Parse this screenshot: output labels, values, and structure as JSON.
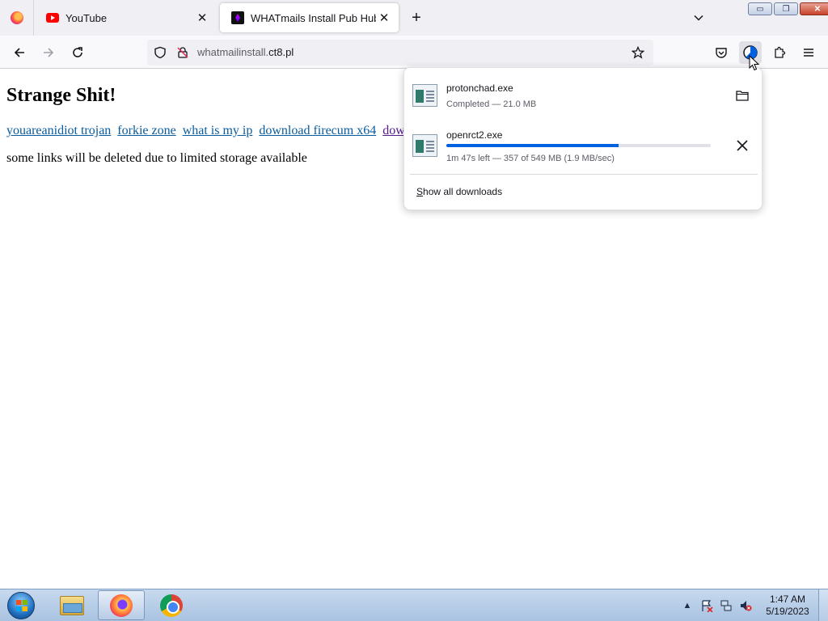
{
  "browser": {
    "tabs": [
      {
        "label": "YouTube",
        "active": false
      },
      {
        "label": "WHATmails Install Pub Hub",
        "active": true
      }
    ],
    "new_tab_symbol": "+",
    "url": {
      "prefix": "whatmailinstall.",
      "domain": "ct8.pl"
    },
    "window_controls": {
      "minimize": "▭",
      "maximize": "❐",
      "close": "✕"
    }
  },
  "page": {
    "heading": "Strange Shit!",
    "links": [
      {
        "label": "youareanidiot trojan",
        "visited": false
      },
      {
        "label": "forkie zone",
        "visited": false
      },
      {
        "label": "what is my ip",
        "visited": false
      },
      {
        "label": "download firecum x64",
        "visited": false
      },
      {
        "label": "downl",
        "visited": true
      }
    ],
    "note": "some links will be deleted due to limited storage available"
  },
  "downloads": {
    "items": [
      {
        "name": "protonchad.exe",
        "status": "Completed — 21.0 MB",
        "action": "open-folder"
      },
      {
        "name": "openrct2.exe",
        "status": "1m 47s left — 357 of 549 MB (1.9 MB/sec)",
        "progress": 0.65,
        "action": "cancel"
      }
    ],
    "show_all_prefix": "S",
    "show_all_rest": "how all downloads"
  },
  "taskbar": {
    "apps": [
      {
        "name": "Windows Explorer",
        "icon": "folder-icon",
        "active": false
      },
      {
        "name": "Firefox",
        "icon": "firefox-icon",
        "active": true
      },
      {
        "name": "Google Chrome",
        "icon": "chrome-icon",
        "active": false
      }
    ],
    "tray_arrow": "▲",
    "clock": {
      "time": "1:47 AM",
      "date": "5/19/2023"
    }
  },
  "colors": {
    "link": "#0a5b9c",
    "visited_link": "#551a8b",
    "progress": "#0061e0",
    "taskbar": "#b9cfe8"
  }
}
